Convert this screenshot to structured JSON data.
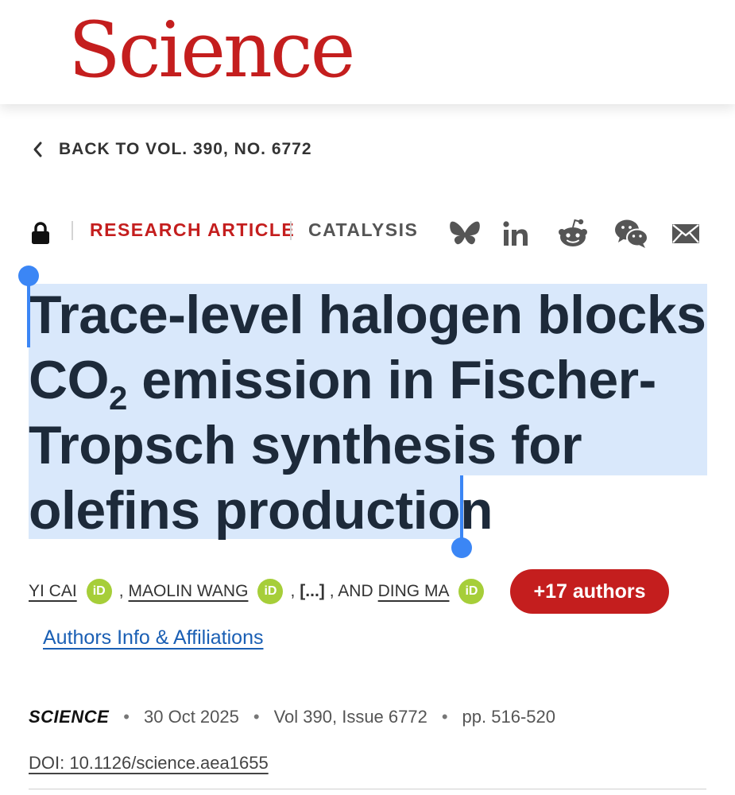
{
  "masthead": {
    "logo_text": "Science",
    "brand_color": "#c41e1e"
  },
  "nav": {
    "back_label": "BACK TO VOL. 390, NO. 6772"
  },
  "article_meta": {
    "article_type": "RESEARCH ARTICLE",
    "subject": "CATALYSIS",
    "access_icon": "lock-icon",
    "share_icons": [
      "bluesky-icon",
      "linkedin-icon",
      "reddit-icon",
      "wechat-icon",
      "email-icon"
    ]
  },
  "title": {
    "part1": "Trace-level halogen blocks CO",
    "subscript": "2",
    "part2": " emission in Fischer-Tropsch synthesis for olefins production",
    "selection_color": "#d9e8fb",
    "handle_color": "#3b86f5"
  },
  "authors": {
    "author1": "YI CAI",
    "author2": "MAOLIN WANG",
    "sep1": ",",
    "sep2": ",",
    "ellipsis": "[...]",
    "and_text": ", AND",
    "author3": "DING MA",
    "orcid_label": "iD",
    "more_button": "+17 authors"
  },
  "affiliations_link": "Authors Info & Affiliations",
  "publication": {
    "journal": "SCIENCE",
    "separator": "•",
    "date": "30 Oct 2025",
    "volume_issue": "Vol 390, Issue 6772",
    "pages": "pp. 516-520",
    "doi": "DOI: 10.1126/science.aea1655"
  }
}
